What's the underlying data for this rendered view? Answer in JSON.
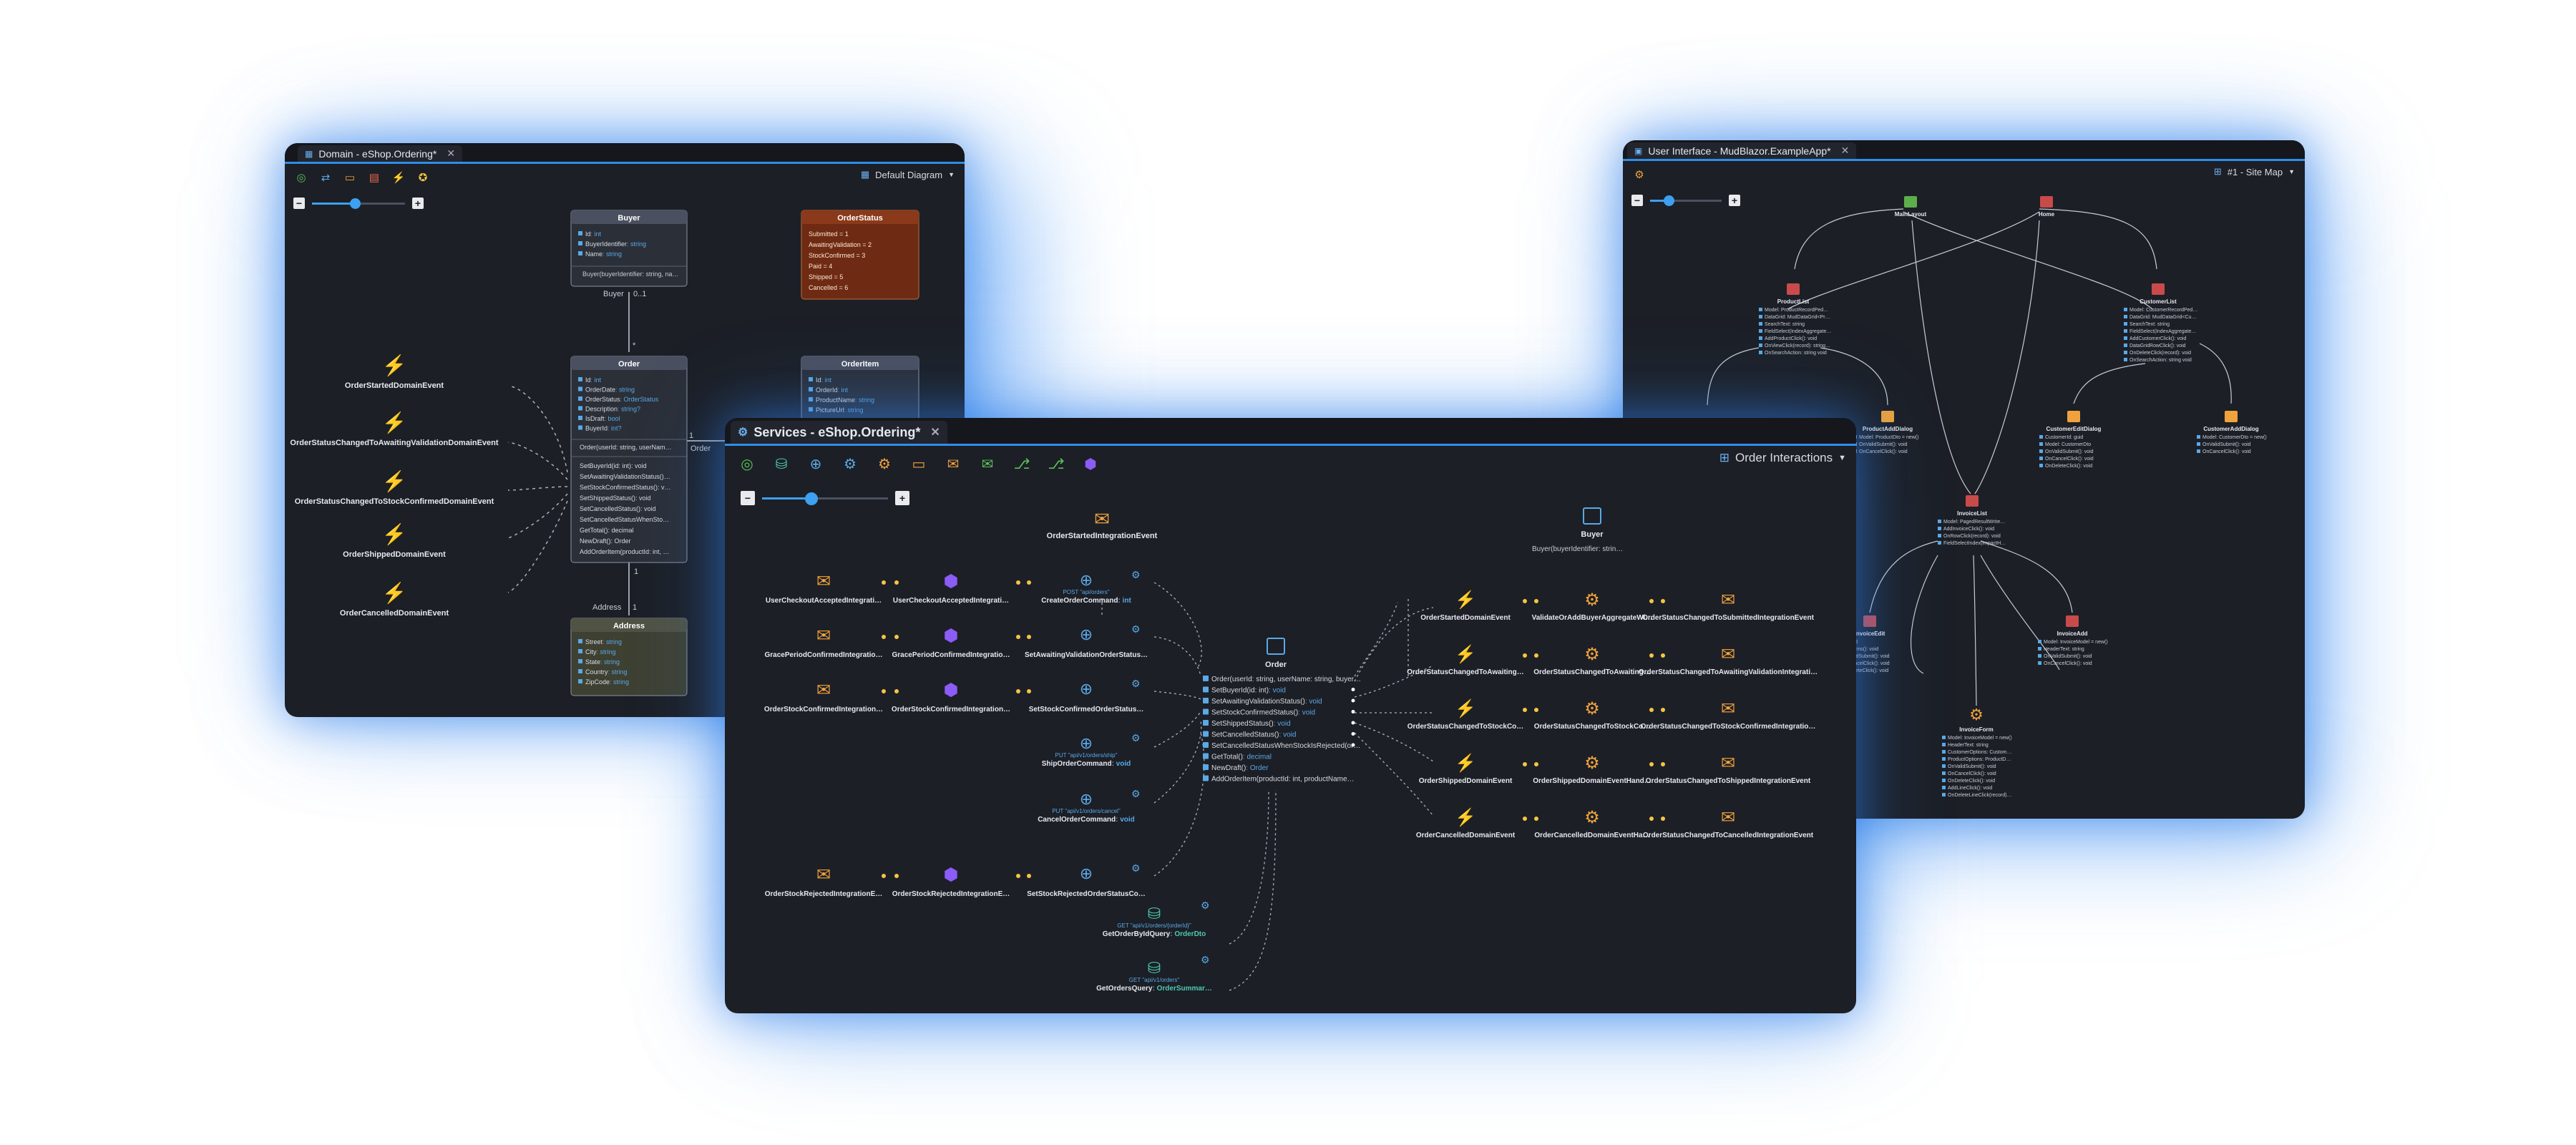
{
  "domain_window": {
    "tab_title": "Domain - eShop.Ordering*",
    "diagram_selector": "Default Diagram",
    "buyer": {
      "title": "Buyer",
      "props": [
        [
          "Id",
          "int"
        ],
        [
          "BuyerIdentifier",
          "string"
        ],
        [
          "Name",
          "string"
        ]
      ],
      "method": "Buyer(buyerIdentifier: string, na…"
    },
    "order_status": {
      "title": "OrderStatus",
      "values": [
        "Submitted = 1",
        "AwaitingValidation = 2",
        "StockConfirmed = 3",
        "Paid = 4",
        "Shipped = 5",
        "Cancelled = 6"
      ]
    },
    "order": {
      "title": "Order",
      "props": [
        [
          "Id",
          "int"
        ],
        [
          "OrderDate",
          "string"
        ],
        [
          "OrderStatus",
          "OrderStatus"
        ],
        [
          "Description",
          "string?"
        ],
        [
          "IsDraft",
          "bool"
        ],
        [
          "BuyerId",
          "int?"
        ]
      ],
      "constructor": "Order(userId: string, userNam…",
      "methods": [
        "SetBuyerId(id: int): void",
        "SetAwaitingValidationStatus()…",
        "SetStockConfirmedStatus(): v…",
        "SetShippedStatus(): void",
        "SetCancelledStatus(): void",
        "SetCancelledStatusWhenSto…",
        "GetTotal(): decimal",
        "NewDraft(): Order",
        "AddOrderItem(productId: int, …"
      ]
    },
    "order_item": {
      "title": "OrderItem",
      "props": [
        [
          "Id",
          "int"
        ],
        [
          "OrderId",
          "int"
        ],
        [
          "ProductName",
          "string"
        ],
        [
          "PictureUrl",
          "string"
        ]
      ]
    },
    "address": {
      "title": "Address",
      "props": [
        [
          "Street",
          "string"
        ],
        [
          "City",
          "string"
        ],
        [
          "State",
          "string"
        ],
        [
          "Country",
          "string"
        ],
        [
          "ZipCode",
          "string"
        ]
      ]
    },
    "relations": {
      "buyer_label": "Buyer",
      "buyer_mult": "0..1",
      "buyer_star": "*",
      "order_item_label": "Order",
      "order_item_mult_a": "1",
      "order_item_mult_b": "1",
      "address_label": "Address",
      "address_mult_a": "1",
      "address_mult_b": "1"
    },
    "domain_events": [
      "OrderStartedDomainEvent",
      "OrderStatusChangedToAwaitingValidationDomainEvent",
      "OrderStatusChangedToStockConfirmedDomainEvent",
      "OrderShippedDomainEvent",
      "OrderCancelledDomainEvent"
    ]
  },
  "ui_window": {
    "tab_title": "User Interface - MudBlazor.ExampleApp*",
    "diagram_selector": "#1 - Site Map",
    "nodes": {
      "main_layout": "MainLayout",
      "home": "Home",
      "product_list": "ProductList",
      "customer_list": "CustomerList",
      "invoice_list": "InvoiceList",
      "product_add_dialog": "ProductAddDialog",
      "customer_edit_dialog": "CustomerEditDialog",
      "customer_add_dialog": "CustomerAddDialog",
      "invoice_edit": "InvoiceEdit",
      "invoice_add": "InvoiceAdd",
      "invoice_form": "InvoiceForm"
    },
    "product_list_lines": [
      "Model: ProductRecordPed…",
      "DataGrid: MudDataGrid<Pr…",
      "SearchText: string",
      "FieldSelect(IndexAggregate…",
      "AddProductClick(): void",
      "OnViewClick(record): string…",
      "OnSearchAction: string void"
    ],
    "customer_list_lines": [
      "Model: CustomerRecordPed…",
      "DataGrid: MudDataGrid<Cu…",
      "SearchText: string",
      "FieldSelect(IndexAggregate…",
      "AddCustomerClick(): void",
      "DataGridRowClick(): void",
      "OnDeleteClick(record): void",
      "OnSearchAction: string void"
    ],
    "product_add_lines": [
      "Model: ProductDto = new()",
      "OnValidSubmit(): void",
      "OnCancelClick(): void"
    ],
    "customer_edit_lines": [
      "CustomerId: guid",
      "Model: CustomerDto",
      "OnValidSubmit(): void",
      "OnCancelClick(): void",
      "OnDeleteClick(): void"
    ],
    "customer_add_lines": [
      "Model: CustomerDto = new()",
      "OnValidSubmit(): void",
      "OnCancelClick(): void"
    ],
    "invoice_list_lines": [
      "Model: PagedResultWrite…",
      "AddInvoiceClick(): void",
      "OnRowClick(record): void",
      "FieldSelectIndex(ImpactH…"
    ],
    "invoice_edit_lines": [
      "Id: guid",
      "dataItems(): void",
      "OnValidSubmit(): void",
      "OnCancelClick(): void",
      "OnDeleteClick(): void"
    ],
    "invoice_add_lines": [
      "Model: InvoiceModel = new()",
      "HeaderText: string",
      "OnValidSubmit(): void",
      "OnCancelClick(): void"
    ],
    "invoice_form_lines": [
      "Model: InvoiceModel = new()",
      "HeaderText: string",
      "CustomerOptions: Custom…",
      "ProductOptions: ProductD…",
      "OnValidSubmit(): void",
      "OnCancelClick(): void",
      "OnDeleteClick(): void",
      "AddLineClick(): void",
      "OnDeleteLineClick(record)…"
    ]
  },
  "services_window": {
    "tab_title": "Services - eShop.Ordering*",
    "diagram_selector": "Order Interactions",
    "order_started_integration": "OrderStartedIntegrationEvent",
    "buyer": "Buyer",
    "buyer_ctor": "Buyer(buyerIdentifier: strin…",
    "left_rows": [
      {
        "event": "UserCheckoutAcceptedIntegrati…",
        "handler": "UserCheckoutAcceptedIntegrati…",
        "http": "POST \"api/orders\"",
        "command": "CreateOrderCommand",
        "ret": "int"
      },
      {
        "event": "GracePeriodConfirmedIntegratio…",
        "handler": "GracePeriodConfirmedIntegratio…",
        "http": "",
        "command": "SetAwaitingValidationOrderStatus…",
        "ret": ""
      },
      {
        "event": "OrderStockConfirmedIntegration…",
        "handler": "OrderStockConfirmedIntegration…",
        "http": "",
        "command": "SetStockConfirmedOrderStatus…",
        "ret": ""
      },
      {
        "event": "",
        "handler": "",
        "http": "PUT \"api/v1/orders/ship\"",
        "command": "ShipOrderCommand",
        "ret": "void"
      },
      {
        "event": "",
        "handler": "",
        "http": "PUT \"api/v1/orders/cancel\"",
        "command": "CancelOrderCommand",
        "ret": "void"
      },
      {
        "event": "OrderStockRejectedIntegrationE…",
        "handler": "OrderStockRejectedIntegrationE…",
        "http": "",
        "command": "SetStockRejectedOrderStatusCo…",
        "ret": ""
      }
    ],
    "queries": [
      {
        "http": "GET \"api/v1/orders/{orderId}\"",
        "name": "GetOrderByIdQuery",
        "ret": "OrderDto"
      },
      {
        "http": "GET \"api/v1/orders\"",
        "name": "GetOrdersQuery",
        "ret": "OrderSummar…"
      }
    ],
    "order": {
      "title": "Order",
      "members": [
        [
          "Order(userId: string, userName: string, buyer…",
          ""
        ],
        [
          "SetBuyerId(id: int)",
          "void"
        ],
        [
          "SetAwaitingValidationStatus()",
          "void"
        ],
        [
          "SetStockConfirmedStatus()",
          "void"
        ],
        [
          "SetShippedStatus()",
          "void"
        ],
        [
          "SetCancelledStatus()",
          "void"
        ],
        [
          "SetCancelledStatusWhenStockIsRejected(or…",
          ""
        ],
        [
          "GetTotal()",
          "decimal"
        ],
        [
          "NewDraft()",
          "Order"
        ],
        [
          "AddOrderItem(productId: int, productName…",
          ""
        ]
      ]
    },
    "right_rows": [
      {
        "domain": "OrderStartedDomainEvent",
        "handler": "ValidateOrAddBuyerAggregateWi…",
        "integration": "OrderStatusChangedToSubmittedIntegrationEvent"
      },
      {
        "domain": "OrderStatusChangedToAwaiting…",
        "handler": "OrderStatusChangedToAwaiting…",
        "integration": "OrderStatusChangedToAwaitingValidationIntegrati…"
      },
      {
        "domain": "OrderStatusChangedToStockCo…",
        "handler": "OrderStatusChangedToStockCo…",
        "integration": "OrderStatusChangedToStockConfirmedIntegratio…"
      },
      {
        "domain": "OrderShippedDomainEvent",
        "handler": "OrderShippedDomainEventHand…",
        "integration": "OrderStatusChangedToShippedIntegrationEvent"
      },
      {
        "domain": "OrderCancelledDomainEvent",
        "handler": "OrderCancelledDomainEventHa…",
        "integration": "OrderStatusChangedToCancelledIntegrationEvent"
      }
    ]
  },
  "colors": {
    "window_bg": "#1c1f26",
    "accent": "#2f8ee8",
    "header_bg": "#4a5060",
    "enum_bg": "#6e2a12",
    "event_yellow": "#f5c542",
    "envelope_orange": "#f0a23c",
    "handler_purple": "#8b5cf6",
    "ui_red": "#c94a4a",
    "ui_green": "#5cae4a",
    "type_blue": "#5aa9e6",
    "glow": "#5ea8f2"
  }
}
